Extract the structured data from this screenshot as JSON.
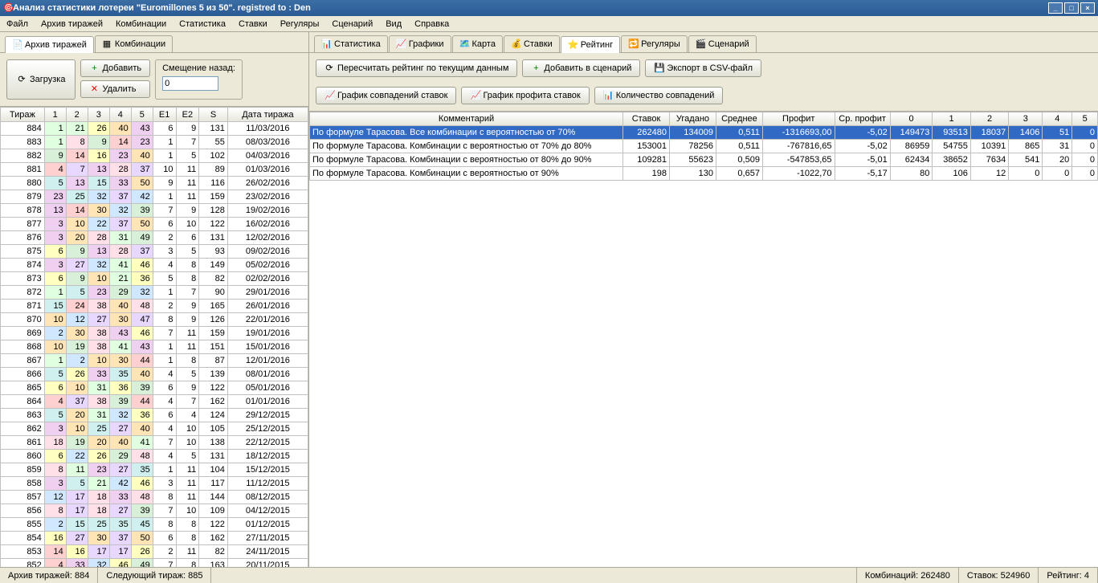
{
  "title": "Анализ статистики лотереи \"Euromillones 5 из 50\". registred to : Den",
  "menu": [
    "Файл",
    "Архив тиражей",
    "Комбинации",
    "Статистика",
    "Ставки",
    "Регуляры",
    "Сценарий",
    "Вид",
    "Справка"
  ],
  "leftTabs": [
    "Архив тиражей",
    "Комбинации"
  ],
  "leftButtons": {
    "load": "Загрузка",
    "add": "Добавить",
    "del": "Удалить"
  },
  "offset": {
    "label": "Смещение назад:",
    "value": "0"
  },
  "drawHeaders": [
    "Тираж",
    "1",
    "2",
    "3",
    "4",
    "5",
    "E1",
    "E2",
    "S",
    "Дата тиража"
  ],
  "draws": [
    [
      "884",
      "1",
      "21",
      "26",
      "40",
      "43",
      "6",
      "9",
      "131",
      "11/03/2016"
    ],
    [
      "883",
      "1",
      "8",
      "9",
      "14",
      "23",
      "1",
      "7",
      "55",
      "08/03/2016"
    ],
    [
      "882",
      "9",
      "14",
      "16",
      "23",
      "40",
      "1",
      "5",
      "102",
      "04/03/2016"
    ],
    [
      "881",
      "4",
      "7",
      "13",
      "28",
      "37",
      "10",
      "11",
      "89",
      "01/03/2016"
    ],
    [
      "880",
      "5",
      "13",
      "15",
      "33",
      "50",
      "9",
      "11",
      "116",
      "26/02/2016"
    ],
    [
      "879",
      "23",
      "25",
      "32",
      "37",
      "42",
      "1",
      "11",
      "159",
      "23/02/2016"
    ],
    [
      "878",
      "13",
      "14",
      "30",
      "32",
      "39",
      "7",
      "9",
      "128",
      "19/02/2016"
    ],
    [
      "877",
      "3",
      "10",
      "22",
      "37",
      "50",
      "6",
      "10",
      "122",
      "16/02/2016"
    ],
    [
      "876",
      "3",
      "20",
      "28",
      "31",
      "49",
      "2",
      "6",
      "131",
      "12/02/2016"
    ],
    [
      "875",
      "6",
      "9",
      "13",
      "28",
      "37",
      "3",
      "5",
      "93",
      "09/02/2016"
    ],
    [
      "874",
      "3",
      "27",
      "32",
      "41",
      "46",
      "4",
      "8",
      "149",
      "05/02/2016"
    ],
    [
      "873",
      "6",
      "9",
      "10",
      "21",
      "36",
      "5",
      "8",
      "82",
      "02/02/2016"
    ],
    [
      "872",
      "1",
      "5",
      "23",
      "29",
      "32",
      "1",
      "7",
      "90",
      "29/01/2016"
    ],
    [
      "871",
      "15",
      "24",
      "38",
      "40",
      "48",
      "2",
      "9",
      "165",
      "26/01/2016"
    ],
    [
      "870",
      "10",
      "12",
      "27",
      "30",
      "47",
      "8",
      "9",
      "126",
      "22/01/2016"
    ],
    [
      "869",
      "2",
      "30",
      "38",
      "43",
      "46",
      "7",
      "11",
      "159",
      "19/01/2016"
    ],
    [
      "868",
      "10",
      "19",
      "38",
      "41",
      "43",
      "1",
      "11",
      "151",
      "15/01/2016"
    ],
    [
      "867",
      "1",
      "2",
      "10",
      "30",
      "44",
      "1",
      "8",
      "87",
      "12/01/2016"
    ],
    [
      "866",
      "5",
      "26",
      "33",
      "35",
      "40",
      "4",
      "5",
      "139",
      "08/01/2016"
    ],
    [
      "865",
      "6",
      "10",
      "31",
      "36",
      "39",
      "6",
      "9",
      "122",
      "05/01/2016"
    ],
    [
      "864",
      "4",
      "37",
      "38",
      "39",
      "44",
      "4",
      "7",
      "162",
      "01/01/2016"
    ],
    [
      "863",
      "5",
      "20",
      "31",
      "32",
      "36",
      "6",
      "4",
      "124",
      "29/12/2015"
    ],
    [
      "862",
      "3",
      "10",
      "25",
      "27",
      "40",
      "4",
      "10",
      "105",
      "25/12/2015"
    ],
    [
      "861",
      "18",
      "19",
      "20",
      "40",
      "41",
      "7",
      "10",
      "138",
      "22/12/2015"
    ],
    [
      "860",
      "6",
      "22",
      "26",
      "29",
      "48",
      "4",
      "5",
      "131",
      "18/12/2015"
    ],
    [
      "859",
      "8",
      "11",
      "23",
      "27",
      "35",
      "1",
      "11",
      "104",
      "15/12/2015"
    ],
    [
      "858",
      "3",
      "5",
      "21",
      "42",
      "46",
      "3",
      "11",
      "117",
      "11/12/2015"
    ],
    [
      "857",
      "12",
      "17",
      "18",
      "33",
      "48",
      "8",
      "11",
      "144",
      "08/12/2015"
    ],
    [
      "856",
      "8",
      "17",
      "18",
      "27",
      "39",
      "7",
      "10",
      "109",
      "04/12/2015"
    ],
    [
      "855",
      "2",
      "15",
      "25",
      "35",
      "45",
      "8",
      "8",
      "122",
      "01/12/2015"
    ],
    [
      "854",
      "16",
      "27",
      "30",
      "37",
      "50",
      "6",
      "8",
      "162",
      "27/11/2015"
    ],
    [
      "853",
      "14",
      "16",
      "17",
      "17",
      "26",
      "2",
      "11",
      "82",
      "24/11/2015"
    ],
    [
      "852",
      "4",
      "33",
      "32",
      "46",
      "49",
      "7",
      "8",
      "163",
      "20/11/2015"
    ]
  ],
  "rightTabs": [
    "Статистика",
    "Графики",
    "Карта",
    "Ставки",
    "Рейтинг",
    "Регуляры",
    "Сценарий"
  ],
  "ratingButtons": {
    "recalc": "Пересчитать рейтинг по текущим данным",
    "addScn": "Добавить в сценарий",
    "export": "Экспорт в CSV-файл",
    "gMatch": "График совпадений ставок",
    "gProfit": "График профита ставок",
    "nMatch": "Количество совпадений"
  },
  "ratingHeaders": [
    "Комментарий",
    "Ставок",
    "Угадано",
    "Среднее",
    "Профит",
    "Ср. профит",
    "0",
    "1",
    "2",
    "3",
    "4",
    "5"
  ],
  "ratingRows": [
    [
      "По формуле Тарасова. Все комбинации с вероятностью от 70%",
      "262480",
      "134009",
      "0,511",
      "-1316693,00",
      "-5,02",
      "149473",
      "93513",
      "18037",
      "1406",
      "51",
      "0"
    ],
    [
      "По формуле Тарасова. Комбинации с вероятностью от 70% до 80%",
      "153001",
      "78256",
      "0,511",
      "-767816,65",
      "-5,02",
      "86959",
      "54755",
      "10391",
      "865",
      "31",
      "0"
    ],
    [
      "По формуле Тарасова. Комбинации с вероятностью от 80% до 90%",
      "109281",
      "55623",
      "0,509",
      "-547853,65",
      "-5,01",
      "62434",
      "38652",
      "7634",
      "541",
      "20",
      "0"
    ],
    [
      "По формуле Тарасова. Комбинации с вероятностью от 90%",
      "198",
      "130",
      "0,657",
      "-1022,70",
      "-5,17",
      "80",
      "106",
      "12",
      "0",
      "0",
      "0"
    ]
  ],
  "status": {
    "archive": "Архив тиражей: 884",
    "next": "Следующий тираж: 885",
    "comb": "Комбинаций: 262480",
    "bets": "Ставок: 524960",
    "rating": "Рейтинг: 4"
  }
}
